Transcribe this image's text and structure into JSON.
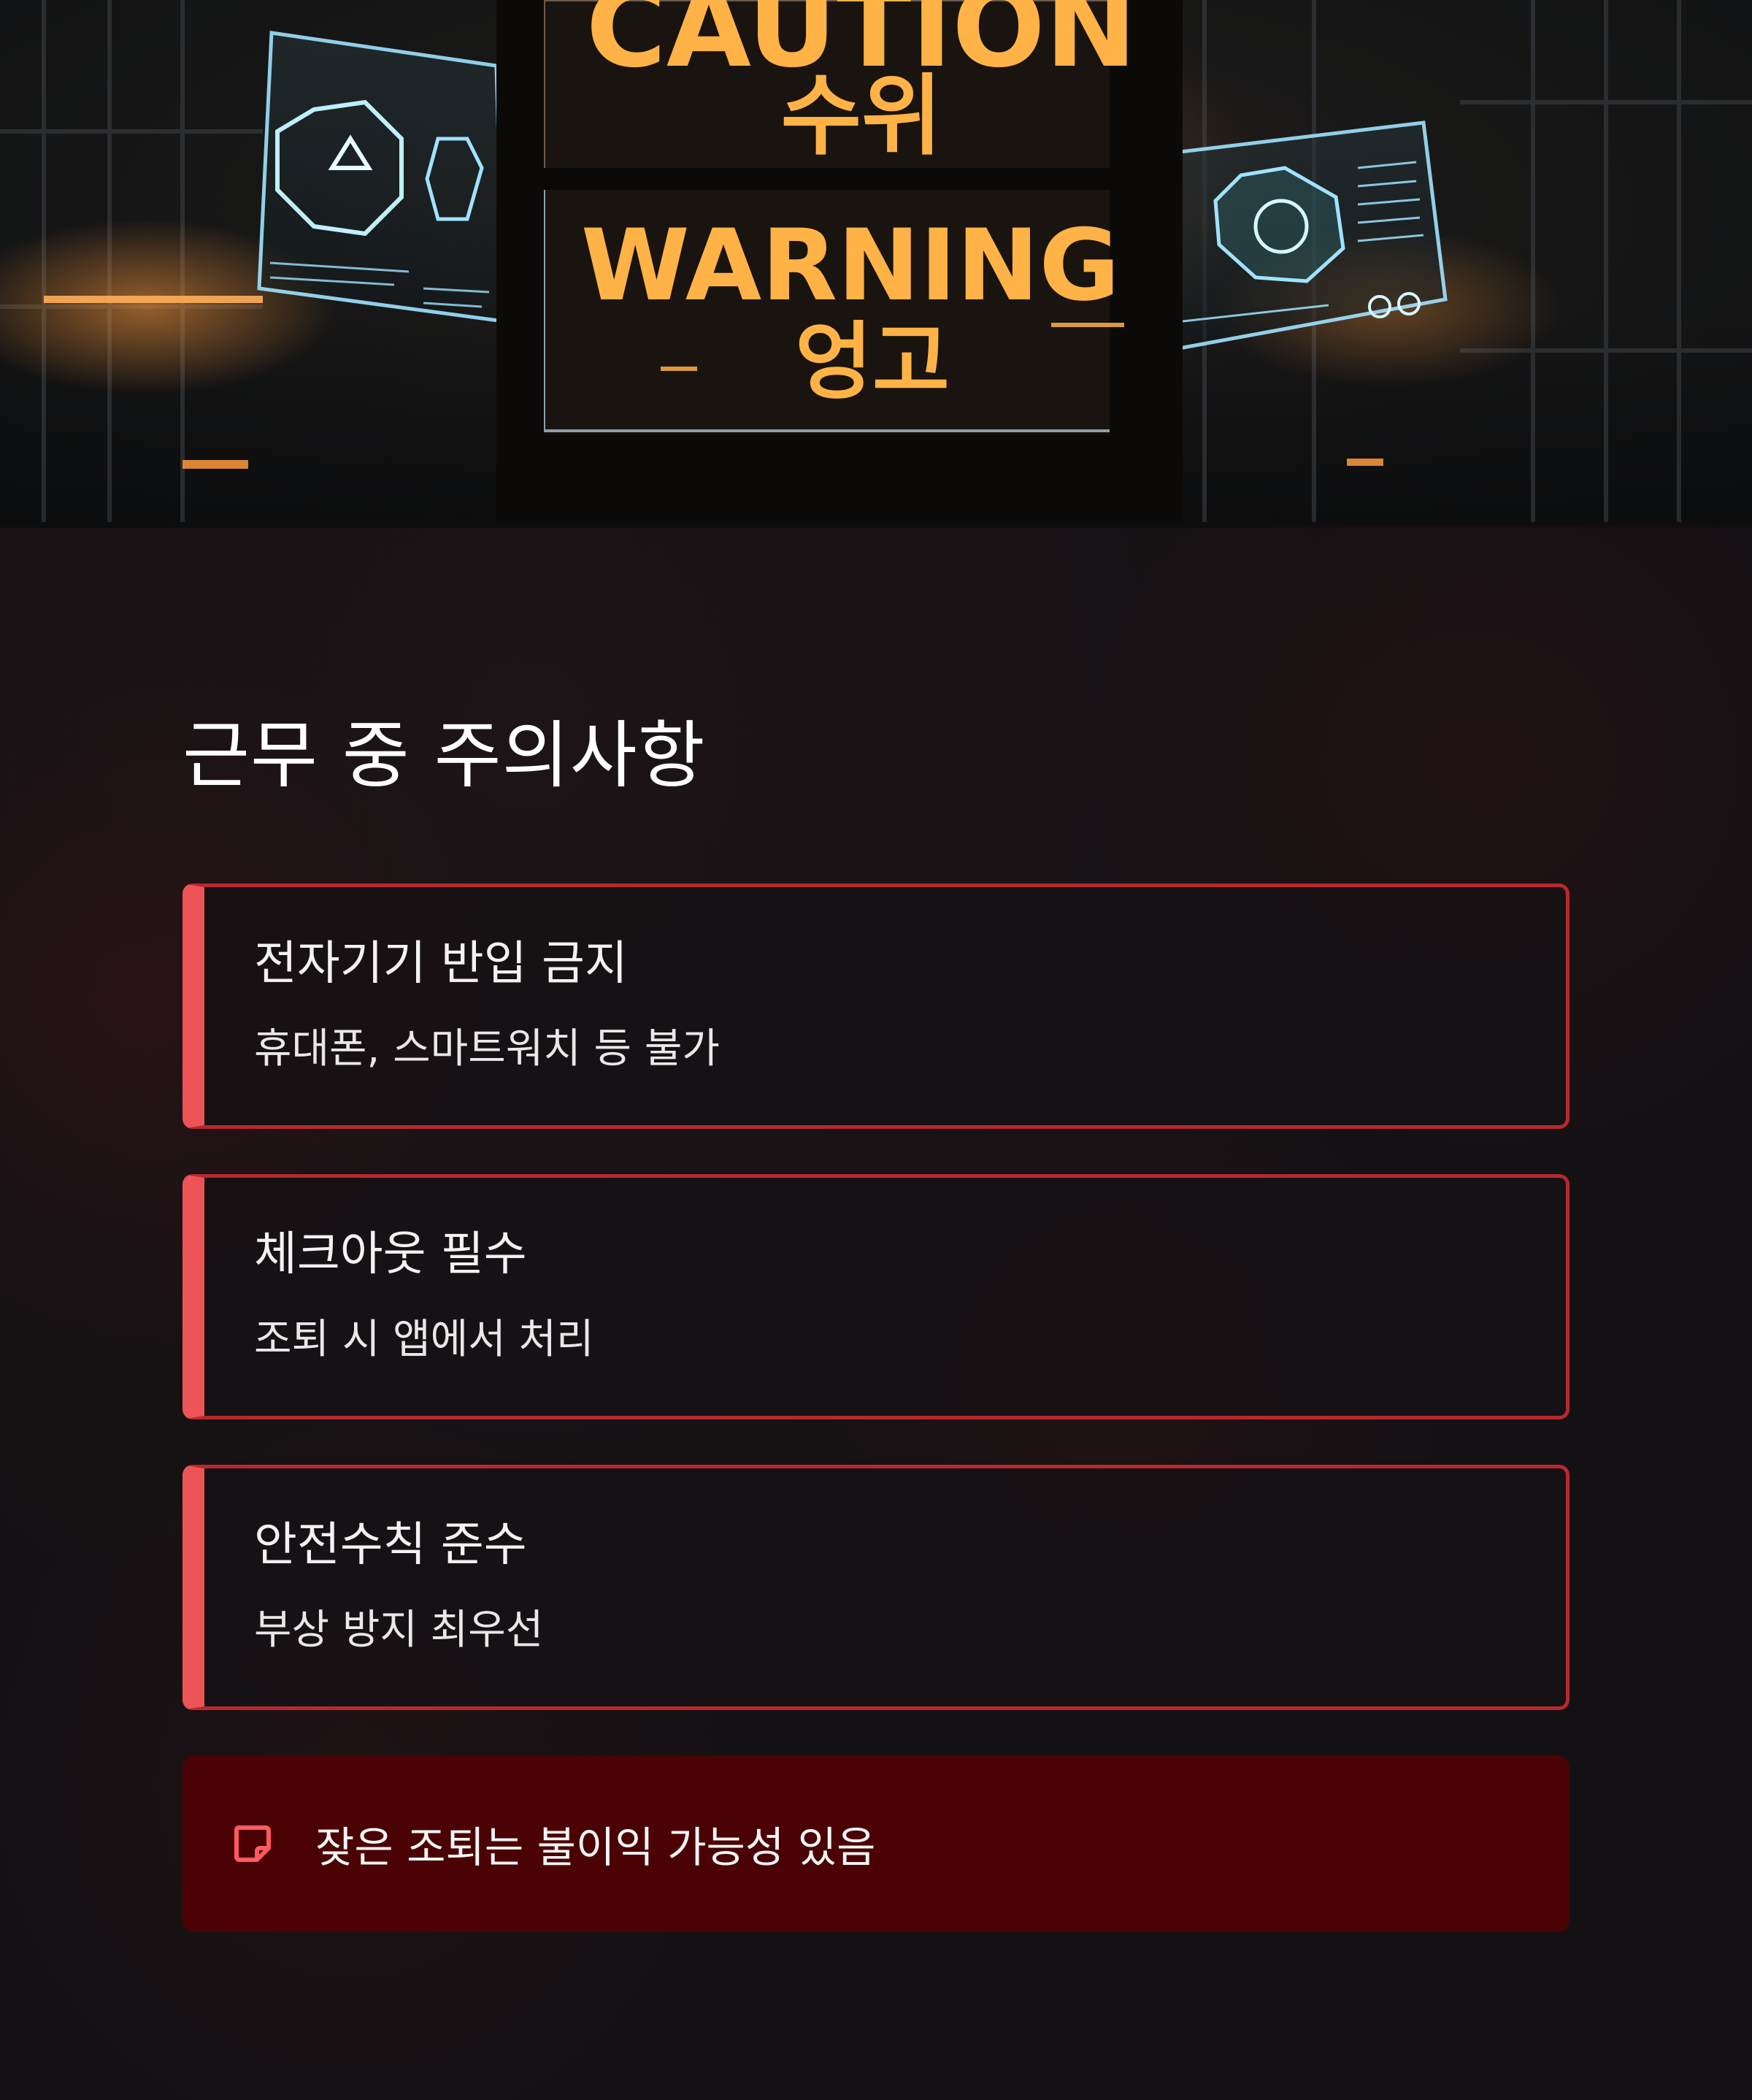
{
  "hero": {
    "sign_top_en": "CAUTION",
    "sign_top_ko": "수위",
    "sign_bottom_en": "WARNING",
    "sign_bottom_ko": "엉고",
    "accent_color": "#ffb347"
  },
  "page_title": "근무 중 주의사항",
  "notices": [
    {
      "title": "전자기기 반입 금지",
      "description": "휴대폰, 스마트워치 등 불가"
    },
    {
      "title": "체크아웃 필수",
      "description": "조퇴 시 앱에서 처리"
    },
    {
      "title": "안전수칙 준수",
      "description": "부상 방지 최우선"
    }
  ],
  "alert": {
    "icon": "note-icon",
    "text": "잦은 조퇴는 불이익 가능성 있음"
  },
  "colors": {
    "background": "#141114",
    "card_border": "#b8282e",
    "card_accent": "#ec5457",
    "alert_background": "#4b0204",
    "alert_icon": "#ff5a5f"
  }
}
